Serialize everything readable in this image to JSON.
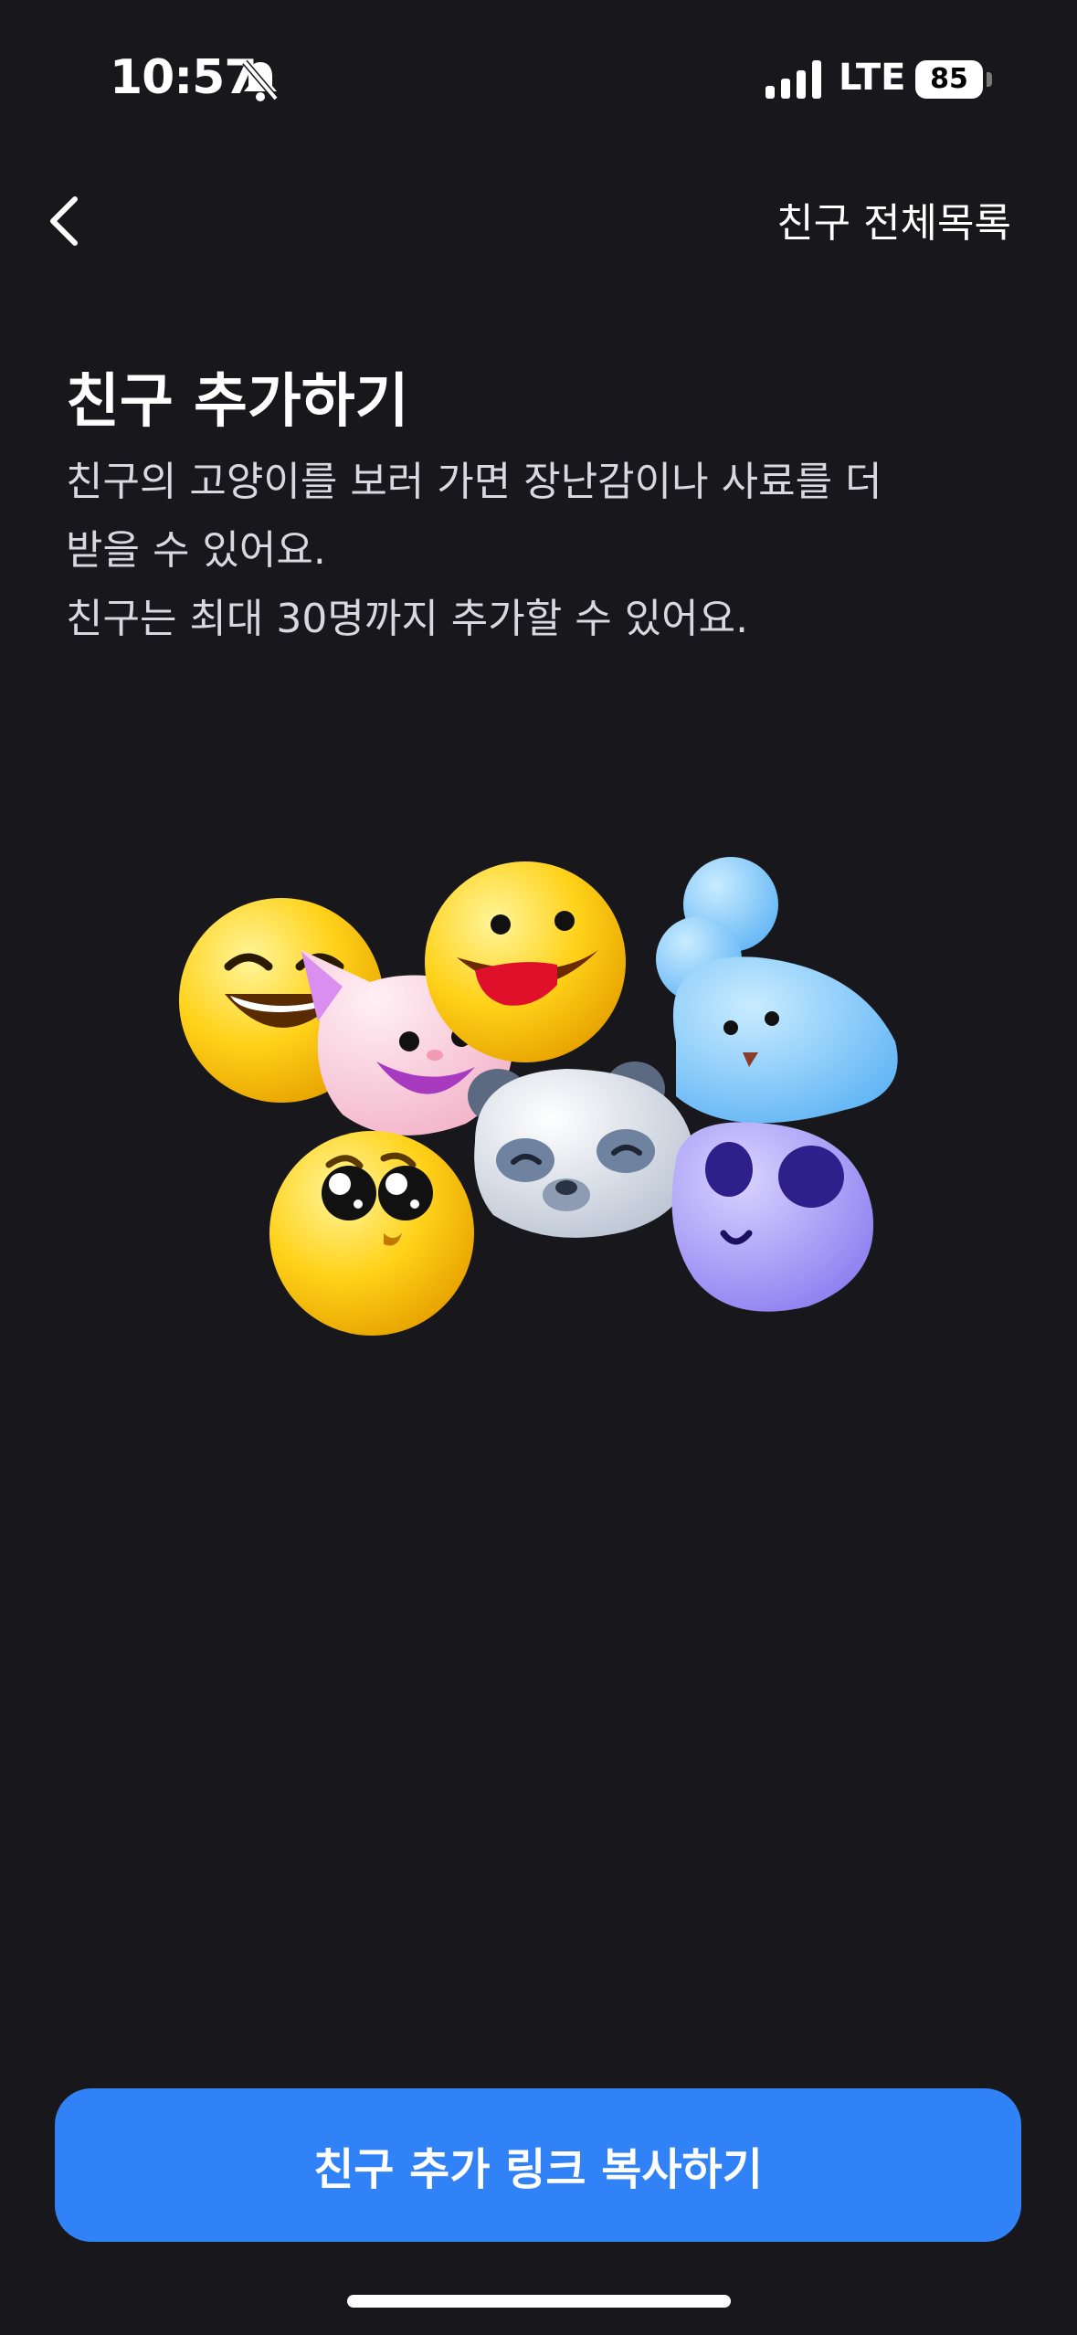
{
  "status_bar": {
    "time": "10:57",
    "network": "LTE",
    "battery": "85",
    "icons": [
      "bell-slash-icon",
      "signal-icon",
      "battery-icon"
    ]
  },
  "nav": {
    "back_icon": "chevron-left-icon",
    "friend_list_label": "친구 전체목록"
  },
  "content": {
    "title": "친구 추가하기",
    "description_lines": [
      "친구의 고양이를 보러 가면 장난감이나 사료를 더",
      "받을 수 있어요.",
      "친구는 최대 30명까지 추가할 수 있어요."
    ]
  },
  "cta": {
    "label": "친구 추가 링크 복사하기"
  },
  "colors": {
    "background": "#18181c",
    "accent": "#3182f6",
    "text": "#ffffff",
    "subtext": "#d8d8de"
  }
}
